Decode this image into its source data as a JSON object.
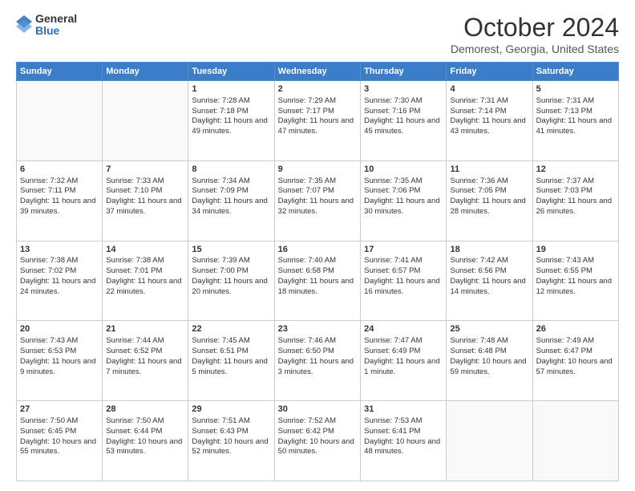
{
  "logo": {
    "general": "General",
    "blue": "Blue"
  },
  "header": {
    "month": "October 2024",
    "location": "Demorest, Georgia, United States"
  },
  "weekdays": [
    "Sunday",
    "Monday",
    "Tuesday",
    "Wednesday",
    "Thursday",
    "Friday",
    "Saturday"
  ],
  "weeks": [
    [
      {
        "day": "",
        "sunrise": "",
        "sunset": "",
        "daylight": "",
        "empty": true
      },
      {
        "day": "",
        "sunrise": "",
        "sunset": "",
        "daylight": "",
        "empty": true
      },
      {
        "day": "1",
        "sunrise": "Sunrise: 7:28 AM",
        "sunset": "Sunset: 7:18 PM",
        "daylight": "Daylight: 11 hours and 49 minutes."
      },
      {
        "day": "2",
        "sunrise": "Sunrise: 7:29 AM",
        "sunset": "Sunset: 7:17 PM",
        "daylight": "Daylight: 11 hours and 47 minutes."
      },
      {
        "day": "3",
        "sunrise": "Sunrise: 7:30 AM",
        "sunset": "Sunset: 7:16 PM",
        "daylight": "Daylight: 11 hours and 45 minutes."
      },
      {
        "day": "4",
        "sunrise": "Sunrise: 7:31 AM",
        "sunset": "Sunset: 7:14 PM",
        "daylight": "Daylight: 11 hours and 43 minutes."
      },
      {
        "day": "5",
        "sunrise": "Sunrise: 7:31 AM",
        "sunset": "Sunset: 7:13 PM",
        "daylight": "Daylight: 11 hours and 41 minutes."
      }
    ],
    [
      {
        "day": "6",
        "sunrise": "Sunrise: 7:32 AM",
        "sunset": "Sunset: 7:11 PM",
        "daylight": "Daylight: 11 hours and 39 minutes."
      },
      {
        "day": "7",
        "sunrise": "Sunrise: 7:33 AM",
        "sunset": "Sunset: 7:10 PM",
        "daylight": "Daylight: 11 hours and 37 minutes."
      },
      {
        "day": "8",
        "sunrise": "Sunrise: 7:34 AM",
        "sunset": "Sunset: 7:09 PM",
        "daylight": "Daylight: 11 hours and 34 minutes."
      },
      {
        "day": "9",
        "sunrise": "Sunrise: 7:35 AM",
        "sunset": "Sunset: 7:07 PM",
        "daylight": "Daylight: 11 hours and 32 minutes."
      },
      {
        "day": "10",
        "sunrise": "Sunrise: 7:35 AM",
        "sunset": "Sunset: 7:06 PM",
        "daylight": "Daylight: 11 hours and 30 minutes."
      },
      {
        "day": "11",
        "sunrise": "Sunrise: 7:36 AM",
        "sunset": "Sunset: 7:05 PM",
        "daylight": "Daylight: 11 hours and 28 minutes."
      },
      {
        "day": "12",
        "sunrise": "Sunrise: 7:37 AM",
        "sunset": "Sunset: 7:03 PM",
        "daylight": "Daylight: 11 hours and 26 minutes."
      }
    ],
    [
      {
        "day": "13",
        "sunrise": "Sunrise: 7:38 AM",
        "sunset": "Sunset: 7:02 PM",
        "daylight": "Daylight: 11 hours and 24 minutes."
      },
      {
        "day": "14",
        "sunrise": "Sunrise: 7:38 AM",
        "sunset": "Sunset: 7:01 PM",
        "daylight": "Daylight: 11 hours and 22 minutes."
      },
      {
        "day": "15",
        "sunrise": "Sunrise: 7:39 AM",
        "sunset": "Sunset: 7:00 PM",
        "daylight": "Daylight: 11 hours and 20 minutes."
      },
      {
        "day": "16",
        "sunrise": "Sunrise: 7:40 AM",
        "sunset": "Sunset: 6:58 PM",
        "daylight": "Daylight: 11 hours and 18 minutes."
      },
      {
        "day": "17",
        "sunrise": "Sunrise: 7:41 AM",
        "sunset": "Sunset: 6:57 PM",
        "daylight": "Daylight: 11 hours and 16 minutes."
      },
      {
        "day": "18",
        "sunrise": "Sunrise: 7:42 AM",
        "sunset": "Sunset: 6:56 PM",
        "daylight": "Daylight: 11 hours and 14 minutes."
      },
      {
        "day": "19",
        "sunrise": "Sunrise: 7:43 AM",
        "sunset": "Sunset: 6:55 PM",
        "daylight": "Daylight: 11 hours and 12 minutes."
      }
    ],
    [
      {
        "day": "20",
        "sunrise": "Sunrise: 7:43 AM",
        "sunset": "Sunset: 6:53 PM",
        "daylight": "Daylight: 11 hours and 9 minutes."
      },
      {
        "day": "21",
        "sunrise": "Sunrise: 7:44 AM",
        "sunset": "Sunset: 6:52 PM",
        "daylight": "Daylight: 11 hours and 7 minutes."
      },
      {
        "day": "22",
        "sunrise": "Sunrise: 7:45 AM",
        "sunset": "Sunset: 6:51 PM",
        "daylight": "Daylight: 11 hours and 5 minutes."
      },
      {
        "day": "23",
        "sunrise": "Sunrise: 7:46 AM",
        "sunset": "Sunset: 6:50 PM",
        "daylight": "Daylight: 11 hours and 3 minutes."
      },
      {
        "day": "24",
        "sunrise": "Sunrise: 7:47 AM",
        "sunset": "Sunset: 6:49 PM",
        "daylight": "Daylight: 11 hours and 1 minute."
      },
      {
        "day": "25",
        "sunrise": "Sunrise: 7:48 AM",
        "sunset": "Sunset: 6:48 PM",
        "daylight": "Daylight: 10 hours and 59 minutes."
      },
      {
        "day": "26",
        "sunrise": "Sunrise: 7:49 AM",
        "sunset": "Sunset: 6:47 PM",
        "daylight": "Daylight: 10 hours and 57 minutes."
      }
    ],
    [
      {
        "day": "27",
        "sunrise": "Sunrise: 7:50 AM",
        "sunset": "Sunset: 6:45 PM",
        "daylight": "Daylight: 10 hours and 55 minutes."
      },
      {
        "day": "28",
        "sunrise": "Sunrise: 7:50 AM",
        "sunset": "Sunset: 6:44 PM",
        "daylight": "Daylight: 10 hours and 53 minutes."
      },
      {
        "day": "29",
        "sunrise": "Sunrise: 7:51 AM",
        "sunset": "Sunset: 6:43 PM",
        "daylight": "Daylight: 10 hours and 52 minutes."
      },
      {
        "day": "30",
        "sunrise": "Sunrise: 7:52 AM",
        "sunset": "Sunset: 6:42 PM",
        "daylight": "Daylight: 10 hours and 50 minutes."
      },
      {
        "day": "31",
        "sunrise": "Sunrise: 7:53 AM",
        "sunset": "Sunset: 6:41 PM",
        "daylight": "Daylight: 10 hours and 48 minutes."
      },
      {
        "day": "",
        "sunrise": "",
        "sunset": "",
        "daylight": "",
        "empty": true
      },
      {
        "day": "",
        "sunrise": "",
        "sunset": "",
        "daylight": "",
        "empty": true
      }
    ]
  ]
}
